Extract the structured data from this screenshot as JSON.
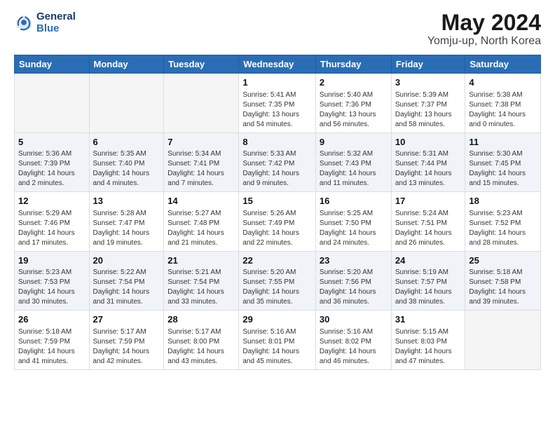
{
  "header": {
    "logo_line1": "General",
    "logo_line2": "Blue",
    "month": "May 2024",
    "location": "Yomju-up, North Korea"
  },
  "weekdays": [
    "Sunday",
    "Monday",
    "Tuesday",
    "Wednesday",
    "Thursday",
    "Friday",
    "Saturday"
  ],
  "weeks": [
    [
      {
        "day": "",
        "info": ""
      },
      {
        "day": "",
        "info": ""
      },
      {
        "day": "",
        "info": ""
      },
      {
        "day": "1",
        "info": "Sunrise: 5:41 AM\nSunset: 7:35 PM\nDaylight: 13 hours\nand 54 minutes."
      },
      {
        "day": "2",
        "info": "Sunrise: 5:40 AM\nSunset: 7:36 PM\nDaylight: 13 hours\nand 56 minutes."
      },
      {
        "day": "3",
        "info": "Sunrise: 5:39 AM\nSunset: 7:37 PM\nDaylight: 13 hours\nand 58 minutes."
      },
      {
        "day": "4",
        "info": "Sunrise: 5:38 AM\nSunset: 7:38 PM\nDaylight: 14 hours\nand 0 minutes."
      }
    ],
    [
      {
        "day": "5",
        "info": "Sunrise: 5:36 AM\nSunset: 7:39 PM\nDaylight: 14 hours\nand 2 minutes."
      },
      {
        "day": "6",
        "info": "Sunrise: 5:35 AM\nSunset: 7:40 PM\nDaylight: 14 hours\nand 4 minutes."
      },
      {
        "day": "7",
        "info": "Sunrise: 5:34 AM\nSunset: 7:41 PM\nDaylight: 14 hours\nand 7 minutes."
      },
      {
        "day": "8",
        "info": "Sunrise: 5:33 AM\nSunset: 7:42 PM\nDaylight: 14 hours\nand 9 minutes."
      },
      {
        "day": "9",
        "info": "Sunrise: 5:32 AM\nSunset: 7:43 PM\nDaylight: 14 hours\nand 11 minutes."
      },
      {
        "day": "10",
        "info": "Sunrise: 5:31 AM\nSunset: 7:44 PM\nDaylight: 14 hours\nand 13 minutes."
      },
      {
        "day": "11",
        "info": "Sunrise: 5:30 AM\nSunset: 7:45 PM\nDaylight: 14 hours\nand 15 minutes."
      }
    ],
    [
      {
        "day": "12",
        "info": "Sunrise: 5:29 AM\nSunset: 7:46 PM\nDaylight: 14 hours\nand 17 minutes."
      },
      {
        "day": "13",
        "info": "Sunrise: 5:28 AM\nSunset: 7:47 PM\nDaylight: 14 hours\nand 19 minutes."
      },
      {
        "day": "14",
        "info": "Sunrise: 5:27 AM\nSunset: 7:48 PM\nDaylight: 14 hours\nand 21 minutes."
      },
      {
        "day": "15",
        "info": "Sunrise: 5:26 AM\nSunset: 7:49 PM\nDaylight: 14 hours\nand 22 minutes."
      },
      {
        "day": "16",
        "info": "Sunrise: 5:25 AM\nSunset: 7:50 PM\nDaylight: 14 hours\nand 24 minutes."
      },
      {
        "day": "17",
        "info": "Sunrise: 5:24 AM\nSunset: 7:51 PM\nDaylight: 14 hours\nand 26 minutes."
      },
      {
        "day": "18",
        "info": "Sunrise: 5:23 AM\nSunset: 7:52 PM\nDaylight: 14 hours\nand 28 minutes."
      }
    ],
    [
      {
        "day": "19",
        "info": "Sunrise: 5:23 AM\nSunset: 7:53 PM\nDaylight: 14 hours\nand 30 minutes."
      },
      {
        "day": "20",
        "info": "Sunrise: 5:22 AM\nSunset: 7:54 PM\nDaylight: 14 hours\nand 31 minutes."
      },
      {
        "day": "21",
        "info": "Sunrise: 5:21 AM\nSunset: 7:54 PM\nDaylight: 14 hours\nand 33 minutes."
      },
      {
        "day": "22",
        "info": "Sunrise: 5:20 AM\nSunset: 7:55 PM\nDaylight: 14 hours\nand 35 minutes."
      },
      {
        "day": "23",
        "info": "Sunrise: 5:20 AM\nSunset: 7:56 PM\nDaylight: 14 hours\nand 36 minutes."
      },
      {
        "day": "24",
        "info": "Sunrise: 5:19 AM\nSunset: 7:57 PM\nDaylight: 14 hours\nand 38 minutes."
      },
      {
        "day": "25",
        "info": "Sunrise: 5:18 AM\nSunset: 7:58 PM\nDaylight: 14 hours\nand 39 minutes."
      }
    ],
    [
      {
        "day": "26",
        "info": "Sunrise: 5:18 AM\nSunset: 7:59 PM\nDaylight: 14 hours\nand 41 minutes."
      },
      {
        "day": "27",
        "info": "Sunrise: 5:17 AM\nSunset: 7:59 PM\nDaylight: 14 hours\nand 42 minutes."
      },
      {
        "day": "28",
        "info": "Sunrise: 5:17 AM\nSunset: 8:00 PM\nDaylight: 14 hours\nand 43 minutes."
      },
      {
        "day": "29",
        "info": "Sunrise: 5:16 AM\nSunset: 8:01 PM\nDaylight: 14 hours\nand 45 minutes."
      },
      {
        "day": "30",
        "info": "Sunrise: 5:16 AM\nSunset: 8:02 PM\nDaylight: 14 hours\nand 46 minutes."
      },
      {
        "day": "31",
        "info": "Sunrise: 5:15 AM\nSunset: 8:03 PM\nDaylight: 14 hours\nand 47 minutes."
      },
      {
        "day": "",
        "info": ""
      }
    ]
  ]
}
